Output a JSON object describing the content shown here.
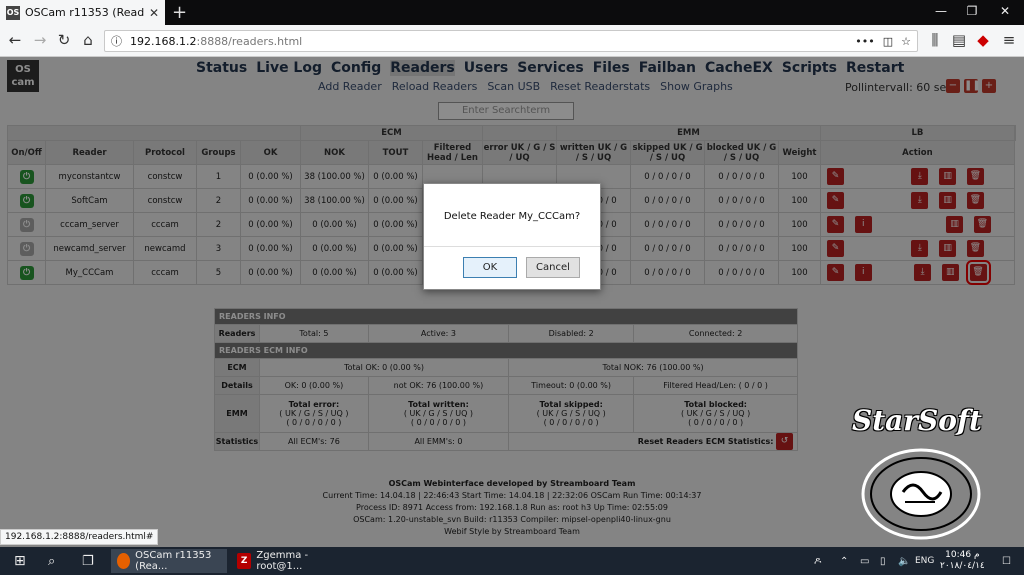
{
  "browser": {
    "tab_title": "OSCam r11353 (Reader)",
    "tab_favicon": "OS",
    "url_host": "192.168.1.2",
    "url_path": ":8888/readers.html",
    "status_url": "192.168.1.2:8888/readers.html#"
  },
  "app": {
    "logo_top": "OS",
    "logo_bottom": "cam",
    "nav": [
      "Status",
      "Live Log",
      "Config",
      "Readers",
      "Users",
      "Services",
      "Files",
      "Failban",
      "CacheEX",
      "Scripts",
      "Restart"
    ],
    "subnav": [
      "Add Reader",
      "Reload Readers",
      "Scan USB",
      "Reset Readerstats",
      "Show Graphs"
    ],
    "poll_interval": "Pollintervall: 60 sec",
    "search_placeholder": "Enter Searchterm"
  },
  "readers_table": {
    "group_headers": {
      "ecm": "ECM",
      "emm": "EMM",
      "lb": "LB"
    },
    "headers": {
      "onoff": "On/Off",
      "reader": "Reader",
      "protocol": "Protocol",
      "groups": "Groups",
      "ok": "OK",
      "nok": "NOK",
      "tout": "TOUT",
      "filtered": "Filtered Head / Len",
      "error": "error UK / G / S / UQ",
      "written": "written UK / G / S / UQ",
      "skipped": "skipped UK / G / S / UQ",
      "blocked": "blocked UK / G / S / UQ",
      "weight": "Weight",
      "action": "Action"
    },
    "rows": [
      {
        "reader": "myconstantcw",
        "protocol": "constcw",
        "groups": "1",
        "ok": "0 (0.00 %)",
        "nok": "38 (100.00 %)",
        "tout": "0 (0.00 %)",
        "filtered": "",
        "error": "",
        "written": "",
        "skipped": "0 / 0 / 0 / 0",
        "blocked": "0 / 0 / 0 / 0",
        "weight": "100"
      },
      {
        "reader": "SoftCam",
        "protocol": "constcw",
        "groups": "2",
        "ok": "0 (0.00 %)",
        "nok": "38 (100.00 %)",
        "tout": "0 (0.00 %)",
        "filtered": "",
        "error": "",
        "written": "0 / 0 / 0 / 0",
        "skipped": "0 / 0 / 0 / 0",
        "blocked": "0 / 0 / 0 / 0",
        "weight": "100"
      },
      {
        "reader": "cccam_server",
        "protocol": "cccam",
        "groups": "2",
        "ok": "0 (0.00 %)",
        "nok": "0 (0.00 %)",
        "tout": "0 (0.00 %)",
        "filtered": "",
        "error": "",
        "written": "0 / 0 / 0 / 0",
        "skipped": "0 / 0 / 0 / 0",
        "blocked": "0 / 0 / 0 / 0",
        "weight": "100"
      },
      {
        "reader": "newcamd_server",
        "protocol": "newcamd",
        "groups": "3",
        "ok": "0 (0.00 %)",
        "nok": "0 (0.00 %)",
        "tout": "0 (0.00 %)",
        "filtered": "",
        "error": "",
        "written": "0 / 0 / 0 / 0",
        "skipped": "0 / 0 / 0 / 0",
        "blocked": "0 / 0 / 0 / 0",
        "weight": "100"
      },
      {
        "reader": "My_CCCam",
        "protocol": "cccam",
        "groups": "5",
        "ok": "0 (0.00 %)",
        "nok": "0 (0.00 %)",
        "tout": "0 (0.00 %)",
        "filtered": "",
        "error": "",
        "written": "0 / 0 / 0 / 0",
        "skipped": "0 / 0 / 0 / 0",
        "blocked": "0 / 0 / 0 / 0",
        "weight": "100"
      }
    ]
  },
  "readers_info": {
    "title": "READERS INFO",
    "label": "Readers",
    "total": "Total: 5",
    "active": "Active: 3",
    "disabled": "Disabled: 2",
    "connected": "Connected: 2",
    "ecm_title": "READERS ECM INFO",
    "ecm_label": "ECM",
    "total_ok": "Total OK: 0 (0.00 %)",
    "total_nok": "Total NOK: 76 (100.00 %)",
    "details_label": "Details",
    "d_ok": "OK: 0 (0.00 %)",
    "d_notok": "not OK: 76 (100.00 %)",
    "d_timeout": "Timeout: 0 (0.00 %)",
    "d_filtered": "Filtered Head/Len: ( 0 / 0 )",
    "emm_label": "EMM",
    "emm_error": "Total error:",
    "emm_written": "Total written:",
    "emm_skipped": "Total skipped:",
    "emm_blocked": "Total blocked:",
    "emm_fmt": "( UK / G / S / UQ )",
    "emm_val": "( 0 / 0 / 0 / 0 )",
    "stats_label": "Statistics",
    "all_ecms": "All ECM's: 76",
    "all_emms": "All EMM's: 0",
    "reset_stats": "Reset Readers ECM Statistics:"
  },
  "footer": {
    "line1": "OSCam Webinterface developed by Streamboard Team",
    "line2": "Current Time: 14.04.18 | 22:46:43 Start Time: 14.04.18 | 22:32:06 OSCam Run Time: 00:14:37",
    "line3": "Process ID: 8971 Access from: 192.168.1.8 Run as: root h3 Up Time: 02:55:09",
    "line4": "OSCam: 1.20-unstable_svn Build: r11353 Compiler: mipsel-openpli40-linux-gnu",
    "line5": "Webif Style by Streamboard Team"
  },
  "dialog": {
    "message": "Delete Reader My_CCCam?",
    "ok": "OK",
    "cancel": "Cancel"
  },
  "taskbar": {
    "firefox": "OSCam r11353 (Rea...",
    "filezilla": "Zgemma - root@1...",
    "lang": "ENG",
    "time": "10:46 م",
    "date": "٢٠١٨/٠٤/١٤"
  },
  "watermark": "StarSoft"
}
